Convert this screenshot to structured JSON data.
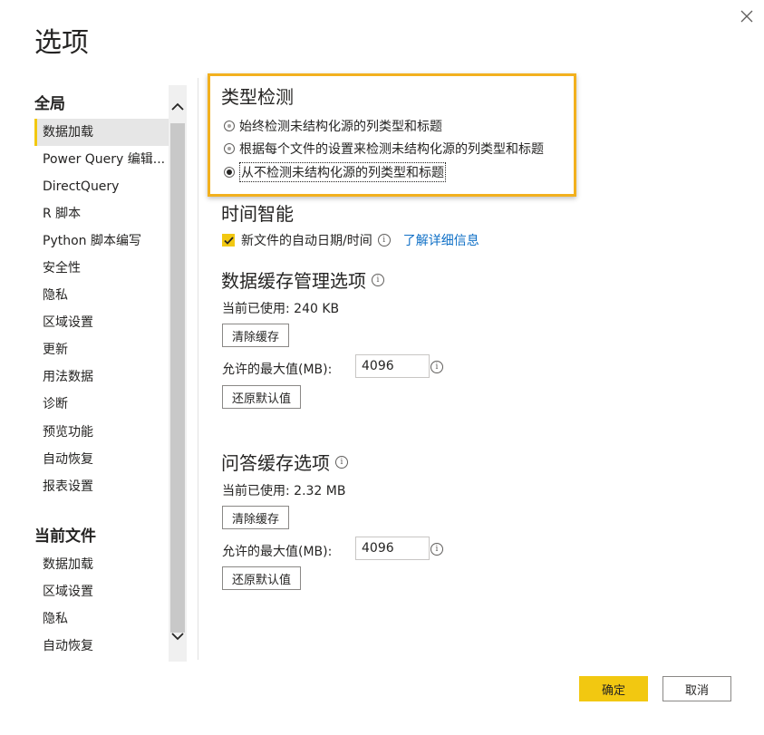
{
  "dialog": {
    "title": "选项",
    "close_icon": "close-icon"
  },
  "sidebar": {
    "global_heading": "全局",
    "global_items": [
      {
        "label": "数据加载",
        "selected": true
      },
      {
        "label": "Power Query 编辑..."
      },
      {
        "label": "DirectQuery"
      },
      {
        "label": "R 脚本"
      },
      {
        "label": "Python 脚本编写"
      },
      {
        "label": "安全性"
      },
      {
        "label": "隐私"
      },
      {
        "label": "区域设置"
      },
      {
        "label": "更新"
      },
      {
        "label": "用法数据"
      },
      {
        "label": "诊断"
      },
      {
        "label": "预览功能"
      },
      {
        "label": "自动恢复"
      },
      {
        "label": "报表设置"
      }
    ],
    "current_file_heading": "当前文件",
    "current_file_items": [
      {
        "label": "数据加载"
      },
      {
        "label": "区域设置"
      },
      {
        "label": "隐私"
      },
      {
        "label": "自动恢复"
      }
    ]
  },
  "type_detection": {
    "title": "类型检测",
    "options": [
      {
        "label": "始终检测未结构化源的列类型和标题",
        "checked": false
      },
      {
        "label": "根据每个文件的设置来检测未结构化源的列类型和标题",
        "checked": false
      },
      {
        "label": "从不检测未结构化源的列类型和标题",
        "checked": true
      }
    ]
  },
  "time_intelligence": {
    "title": "时间智能",
    "auto_date_label": "新文件的自动日期/时间",
    "auto_date_checked": true,
    "learn_more": "了解详细信息"
  },
  "data_cache": {
    "title": "数据缓存管理选项",
    "current_usage": "当前已使用: 240 KB",
    "clear_button": "清除缓存",
    "max_label": "允许的最大值(MB):",
    "max_value": "4096",
    "restore_button": "还原默认值"
  },
  "qa_cache": {
    "title": "问答缓存选项",
    "current_usage": "当前已使用: 2.32 MB",
    "clear_button": "清除缓存",
    "max_label": "允许的最大值(MB):",
    "max_value": "4096",
    "restore_button": "还原默认值"
  },
  "footer": {
    "ok_label": "确定",
    "cancel_label": "取消"
  },
  "colors": {
    "accent": "#f2c811",
    "highlight_border": "#f2b01e",
    "link": "#0e6fc6"
  }
}
